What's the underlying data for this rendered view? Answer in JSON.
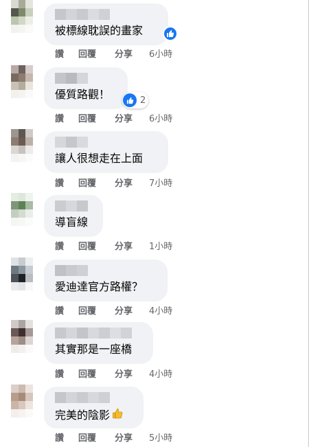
{
  "actions": {
    "like": "讚",
    "reply": "回覆",
    "share": "分享"
  },
  "comments": [
    {
      "text": "被標線耽誤的畫家",
      "time": "6小時",
      "reaction": "like",
      "reaction_count": null
    },
    {
      "text": "優質路觀！",
      "time": "6小時",
      "reaction": "like",
      "reaction_count": "2"
    },
    {
      "text": "讓人很想走在上面",
      "time": "7小時",
      "reaction": null,
      "reaction_count": null
    },
    {
      "text": "導盲線",
      "time": "1小時",
      "reaction": null,
      "reaction_count": null
    },
    {
      "text": "愛迪達官方路權？",
      "time": "4小時",
      "reaction": null,
      "reaction_count": null
    },
    {
      "text": "其實那是一座橋",
      "time": "4小時",
      "reaction": null,
      "reaction_count": null
    },
    {
      "text": "完美的陰影",
      "time": "5小時",
      "reaction": null,
      "reaction_count": null,
      "emoji": "thumbs-up-emoji"
    }
  ],
  "colors": {
    "bubble": "#f0f2f5",
    "like_blue": "#1877f2",
    "meta_text": "#65676b"
  },
  "icons": {
    "like_badge": "like-icon",
    "emoji": "thumbs-up-emoji"
  }
}
